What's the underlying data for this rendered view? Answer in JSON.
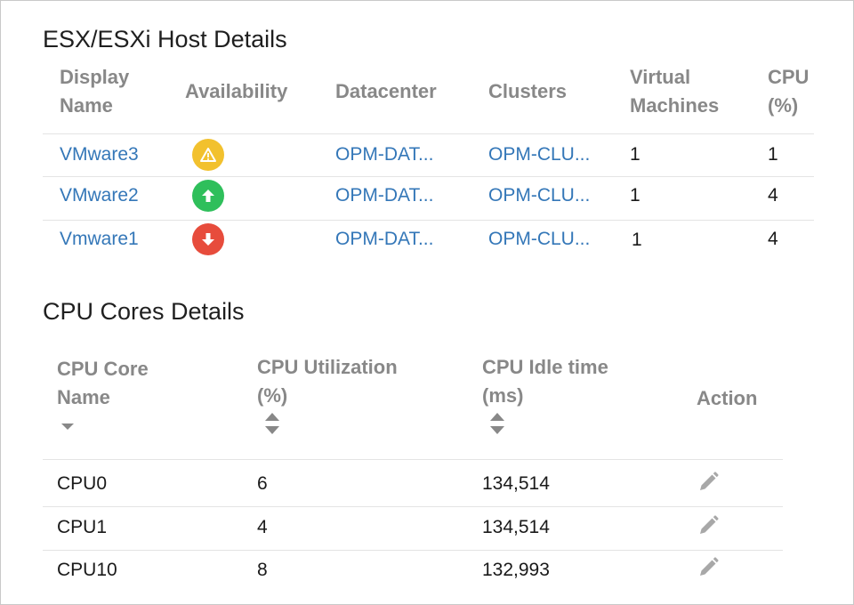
{
  "host_section": {
    "title": "ESX/ESXi Host Details",
    "headers": {
      "display_name": [
        "Display",
        "Name"
      ],
      "availability": "Availability",
      "datacenter": "Datacenter",
      "clusters": "Clusters",
      "virtual_machines": [
        "Virtual",
        "Machines"
      ],
      "cpu_pct": [
        "CPU",
        "(%)"
      ]
    },
    "rows": [
      {
        "name": "VMware3",
        "availability": "warning-icon",
        "datacenter": "OPM-DAT...",
        "cluster": "OPM-CLU...",
        "vms": "1",
        "cpu": "1"
      },
      {
        "name": "VMware2",
        "availability": "up-icon",
        "datacenter": "OPM-DAT...",
        "cluster": "OPM-CLU...",
        "vms": "1",
        "cpu": "4"
      },
      {
        "name": "Vmware1",
        "availability": "down-icon",
        "datacenter": "OPM-DAT...",
        "cluster": "OPM-CLU...",
        "vms": "1",
        "cpu": "4"
      }
    ]
  },
  "cores_section": {
    "title": "CPU Cores Details",
    "headers": {
      "core_name": [
        "CPU Core",
        "Name"
      ],
      "utilization": [
        "CPU Utilization",
        "(%)"
      ],
      "idle_time": [
        "CPU Idle time",
        "(ms)"
      ],
      "action": "Action"
    },
    "rows": [
      {
        "name": "CPU0",
        "utilization": "6",
        "idle": "134,514"
      },
      {
        "name": "CPU1",
        "utilization": "4",
        "idle": "134,514"
      },
      {
        "name": "CPU10",
        "utilization": "8",
        "idle": "132,993"
      }
    ]
  },
  "colors": {
    "link": "#3477b8",
    "header_text": "#888888",
    "warning": "#f2c12e",
    "up": "#2fbf5b",
    "down": "#e74c3c",
    "edit_icon": "#a8a8a8"
  }
}
